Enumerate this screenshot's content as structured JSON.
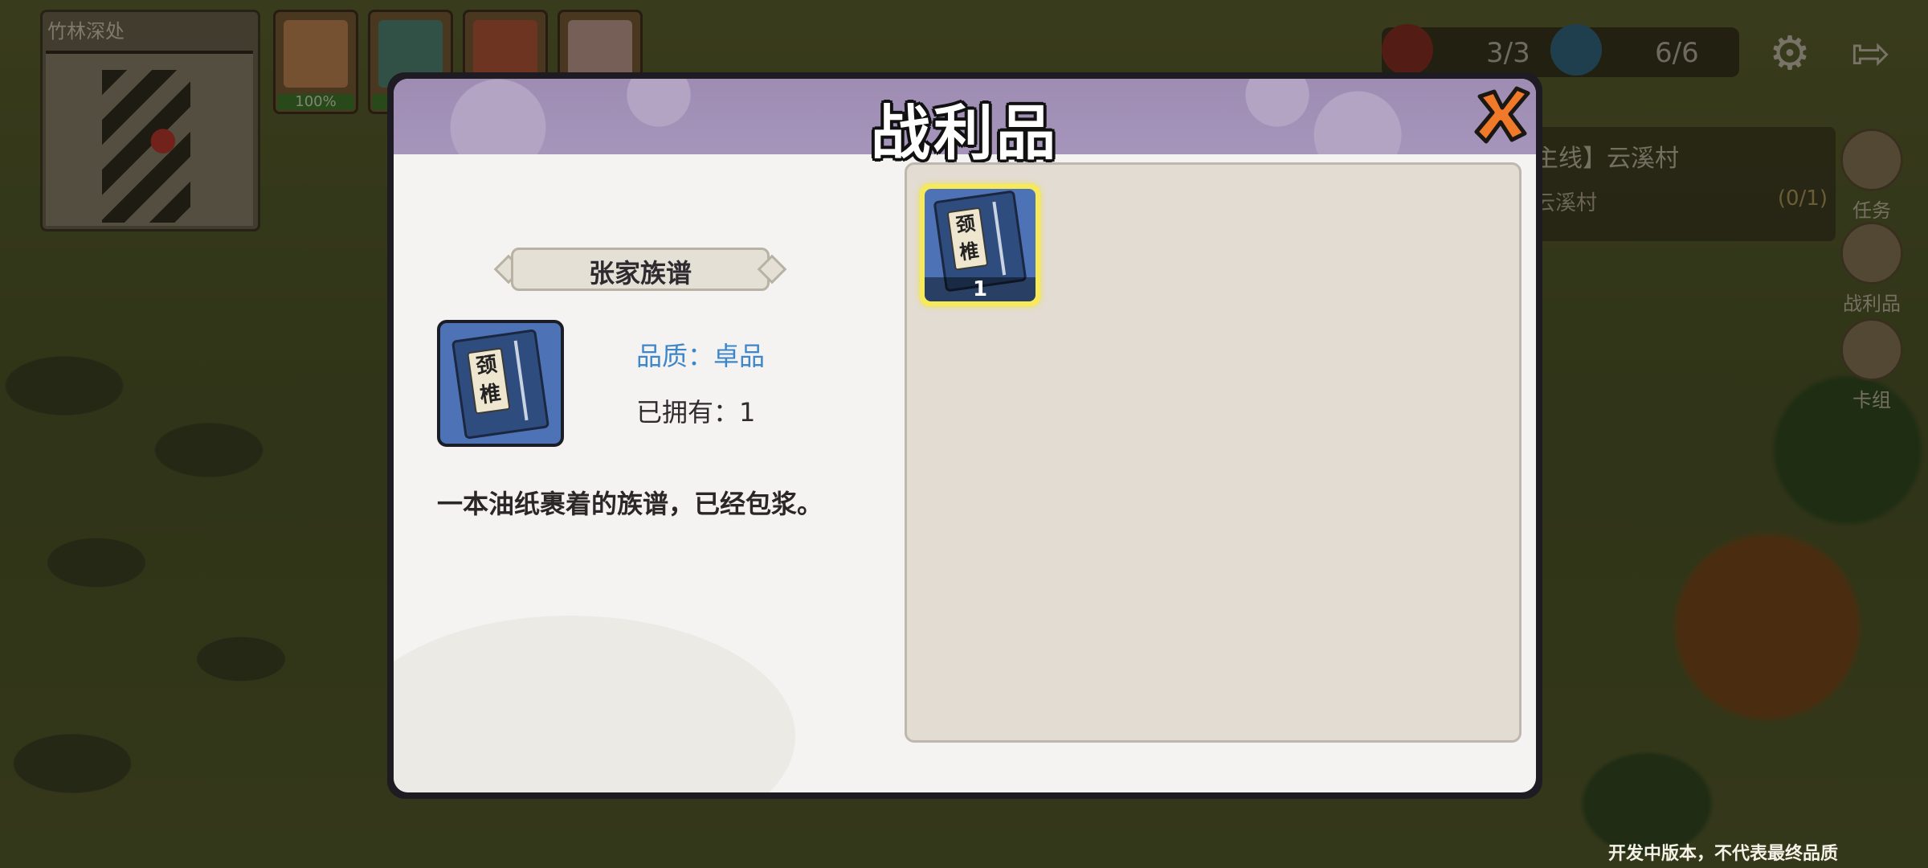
{
  "minimap": {
    "title": "竹林深处"
  },
  "party": [
    {
      "hp": "100%"
    },
    {
      "hp": ""
    },
    {
      "hp": ""
    },
    {
      "hp": ""
    }
  ],
  "resources": {
    "first": "3/3",
    "second": "6/6"
  },
  "quest": {
    "title": "主线】云溪村",
    "objective": "云溪村",
    "progress": "(0/1)"
  },
  "side_menu": {
    "tasks": "任务",
    "loot": "战利品",
    "deck": "卡组"
  },
  "dialog": {
    "title": "战利品",
    "selected_item": {
      "name": "张家族谱",
      "icon_text": "颈椎",
      "quality_label": "品质：卓品",
      "owned_label": "已拥有：1",
      "description": "一本油纸裹着的族谱，已经包浆。"
    },
    "slots": [
      {
        "icon_text": "颈椎",
        "count": "1"
      }
    ]
  },
  "footer": {
    "dev_note": "开发中版本，不代表最终品质"
  },
  "colors": {
    "accent_quality": "#3c86c9",
    "header": "#a695bb",
    "slot_highlight": "#f6ea5a"
  }
}
